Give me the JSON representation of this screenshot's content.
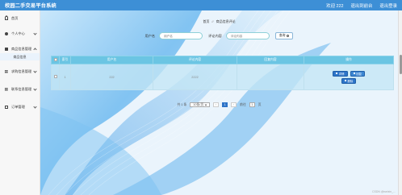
{
  "header": {
    "app_title": "校园二手交易平台系统",
    "user_text": "欢迎 222",
    "exit_label": "退出到前台",
    "logout_label": "退出登录"
  },
  "sidebar": {
    "items": [
      {
        "label": "首页",
        "icon": "home-icon",
        "expandable": false
      },
      {
        "label": "个人中心",
        "icon": "user-icon",
        "expandable": true
      },
      {
        "label": "商品信息管理",
        "icon": "lock-icon",
        "expandable": true,
        "sub": [
          "商品信息"
        ]
      },
      {
        "label": "求购信息管理",
        "icon": "grid-icon",
        "expandable": true
      },
      {
        "label": "联系信息管理",
        "icon": "grid-icon",
        "expandable": true
      },
      {
        "label": "订单管理",
        "icon": "card-icon",
        "expandable": true
      }
    ]
  },
  "breadcrumb": {
    "home": "首页",
    "separator": "//",
    "current": "商品信息评论"
  },
  "search": {
    "username_label": "用户名",
    "username_placeholder": "用户名",
    "comment_label": "评论内容",
    "comment_placeholder": "评论内容",
    "button_label": "查询"
  },
  "table": {
    "columns": [
      "索引",
      "用户名",
      "评论内容",
      "回复内容",
      "操作"
    ],
    "rows": [
      {
        "index": "1",
        "username": "222",
        "comment": "2222",
        "reply": ""
      }
    ],
    "actions": {
      "detail": "详情",
      "edit": "回复",
      "delete": "删除"
    }
  },
  "pagination": {
    "total_text": "共 1 条",
    "page_size": "10条/页",
    "current_page": "1",
    "goto_prefix": "前往",
    "goto_value": "1",
    "goto_suffix": "页"
  },
  "watermark": "CSDN @weixin_..."
}
